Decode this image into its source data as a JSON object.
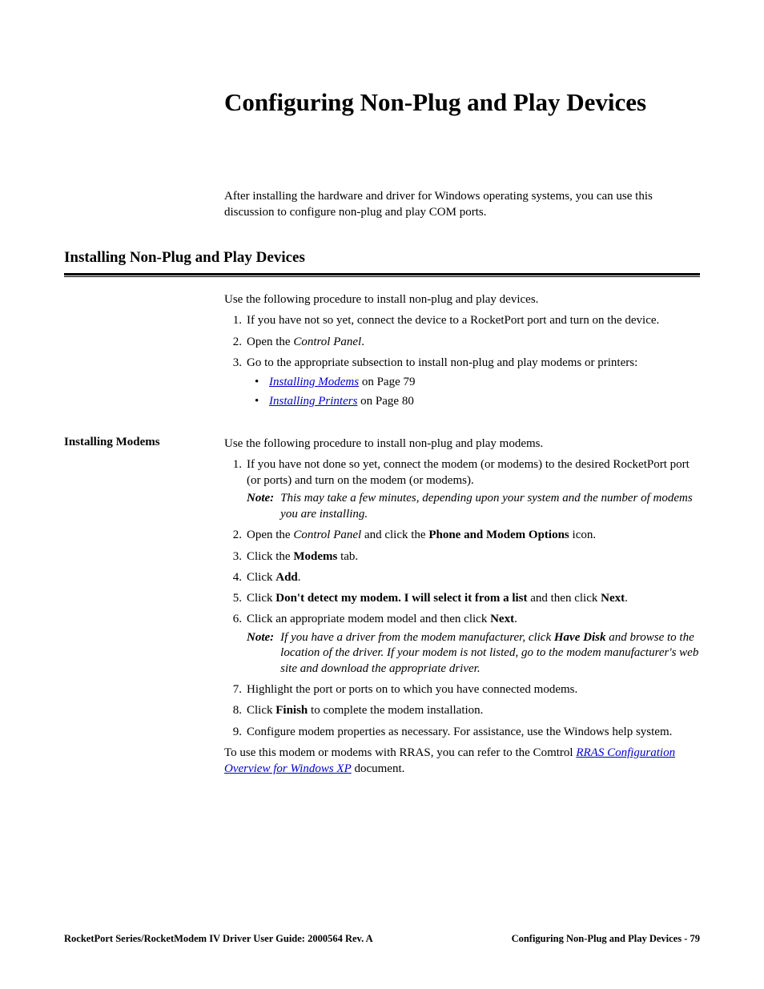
{
  "title": "Configuring Non-Plug and Play Devices",
  "intro": "After installing the hardware and driver for Windows operating systems, you can use this discussion to configure non-plug and play COM ports.",
  "section1": {
    "heading": "Installing Non-Plug and Play Devices",
    "intro": "Use the following procedure to install non-plug and play devices.",
    "steps": {
      "s1": "If you have not so yet, connect the device to a RocketPort port and turn on the device.",
      "s2_pre": "Open the ",
      "s2_em": "Control Panel",
      "s2_post": ".",
      "s3": "Go to the appropriate subsection to install non-plug and play modems or printers:",
      "b1_link": "Installing Modems",
      "b1_rest": " on Page 79",
      "b2_link": "Installing Printers",
      "b2_rest": " on Page 80"
    }
  },
  "section2": {
    "side": "Installing Modems",
    "intro": "Use the following procedure to install non-plug and play modems.",
    "s1": "If you have not done so yet, connect the modem (or modems) to the desired RocketPort port (or ports) and turn on the modem (or modems).",
    "note1_label": "Note:",
    "note1_text": "This may take a few minutes, depending upon your system and the number of modems you are installing.",
    "s2_pre": "Open the ",
    "s2_em": "Control Panel",
    "s2_mid": " and click the ",
    "s2_bold": "Phone and Modem Options",
    "s2_post": " icon.",
    "s3_pre": "Click the ",
    "s3_bold": "Modems",
    "s3_post": " tab.",
    "s4_pre": "Click ",
    "s4_bold": "Add",
    "s4_post": ".",
    "s5_pre": "Click ",
    "s5_bold1": "Don't detect my modem. I will select it from a list",
    "s5_mid": " and then click ",
    "s5_bold2": "Next",
    "s5_post": ".",
    "s6_pre": "Click an appropriate modem model and then click ",
    "s6_bold": "Next",
    "s6_post": ".",
    "note2_label": "Note:",
    "note2_pre": "If you have a driver from the modem manufacturer, click ",
    "note2_bold": "Have Disk",
    "note2_post": " and browse to the location of the driver. If your modem is not listed, go to the modem manufacturer's web site and download the appropriate driver.",
    "s7": "Highlight the port or ports on to which you have connected modems.",
    "s8_pre": "Click ",
    "s8_bold": "Finish",
    "s8_post": " to complete the modem installation.",
    "s9": "Configure modem properties as necessary. For assistance, use the Windows help system.",
    "closing_pre": "To use this modem or modems with RRAS, you can refer to the Comtrol ",
    "closing_link": "RRAS Configuration Overview for Windows XP",
    "closing_post": " document."
  },
  "footer": {
    "left": "RocketPort Series/RocketModem IV Driver User Guide: 2000564 Rev. A",
    "right": "Configuring Non-Plug and Play Devices - 79"
  }
}
